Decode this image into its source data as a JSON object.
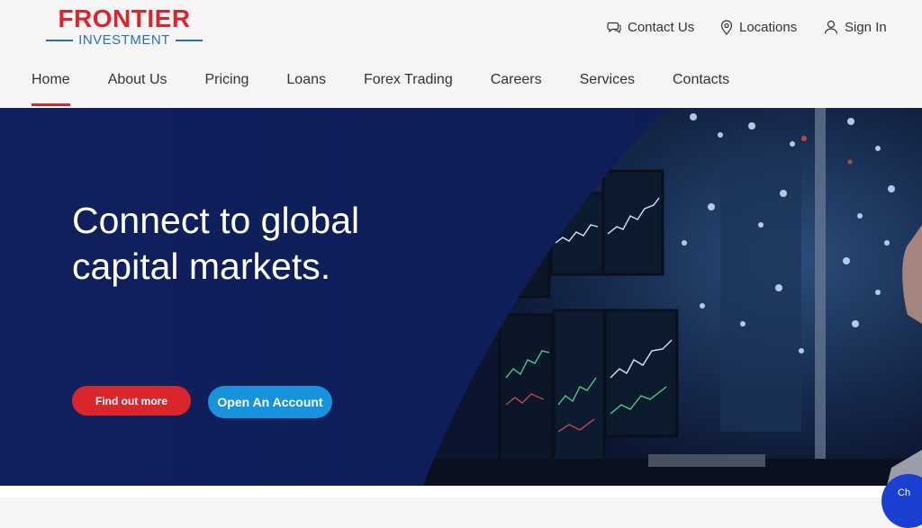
{
  "brand": {
    "name": "FRONTIER",
    "sub": "INVESTMENT",
    "primary_color": "#d9262c",
    "secondary_color": "#2b6fb6"
  },
  "utility_nav": [
    {
      "label": "Contact Us",
      "icon": "chat-bubble-icon"
    },
    {
      "label": "Locations",
      "icon": "map-pin-icon"
    },
    {
      "label": "Sign In",
      "icon": "user-icon"
    }
  ],
  "main_nav": [
    {
      "label": "Home",
      "active": true
    },
    {
      "label": "About Us"
    },
    {
      "label": "Pricing"
    },
    {
      "label": "Loans"
    },
    {
      "label": "Forex Trading"
    },
    {
      "label": "Careers"
    },
    {
      "label": "Services"
    },
    {
      "label": "Contacts"
    }
  ],
  "hero": {
    "title_line1": "Connect to global",
    "title_line2": "capital markets.",
    "primary_button": "Find out more",
    "secondary_button": "Open An Account",
    "background_color": "#0f1f5c",
    "primary_button_color": "#d9262c",
    "secondary_button_color": "#1793dd"
  },
  "chat": {
    "label": "Ch"
  }
}
